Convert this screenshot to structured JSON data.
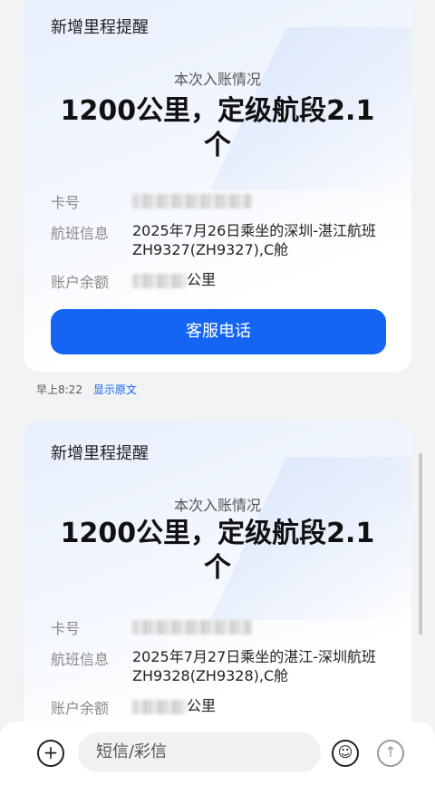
{
  "cards": [
    {
      "title": "新增里程提醒",
      "subtitle": "本次入账情况",
      "amount": "1200公里，定级航段2.1个",
      "card_label": "卡号",
      "flight_label": "航班信息",
      "flight_value": "2025年7月26日乘坐的深圳-湛江航班ZH9327(ZH9327),C舱",
      "balance_label": "账户余额",
      "balance_suffix": "公里",
      "button": "客服电话"
    },
    {
      "title": "新增里程提醒",
      "subtitle": "本次入账情况",
      "amount": "1200公里，定级航段2.1个",
      "card_label": "卡号",
      "flight_label": "航班信息",
      "flight_value": "2025年7月27日乘坐的湛江-深圳航班ZH9328(ZH9328),C舱",
      "balance_label": "账户余额",
      "balance_suffix": "公里"
    }
  ],
  "message_meta": {
    "time": "早上8:22",
    "show_original": "显示原文"
  },
  "composer": {
    "placeholder": "短信/彩信",
    "add_icon": "plus-circle-icon",
    "emoji_icon": "smiley-icon",
    "send_icon": "send-arrow-icon"
  },
  "colors": {
    "accent": "#1565f4"
  }
}
